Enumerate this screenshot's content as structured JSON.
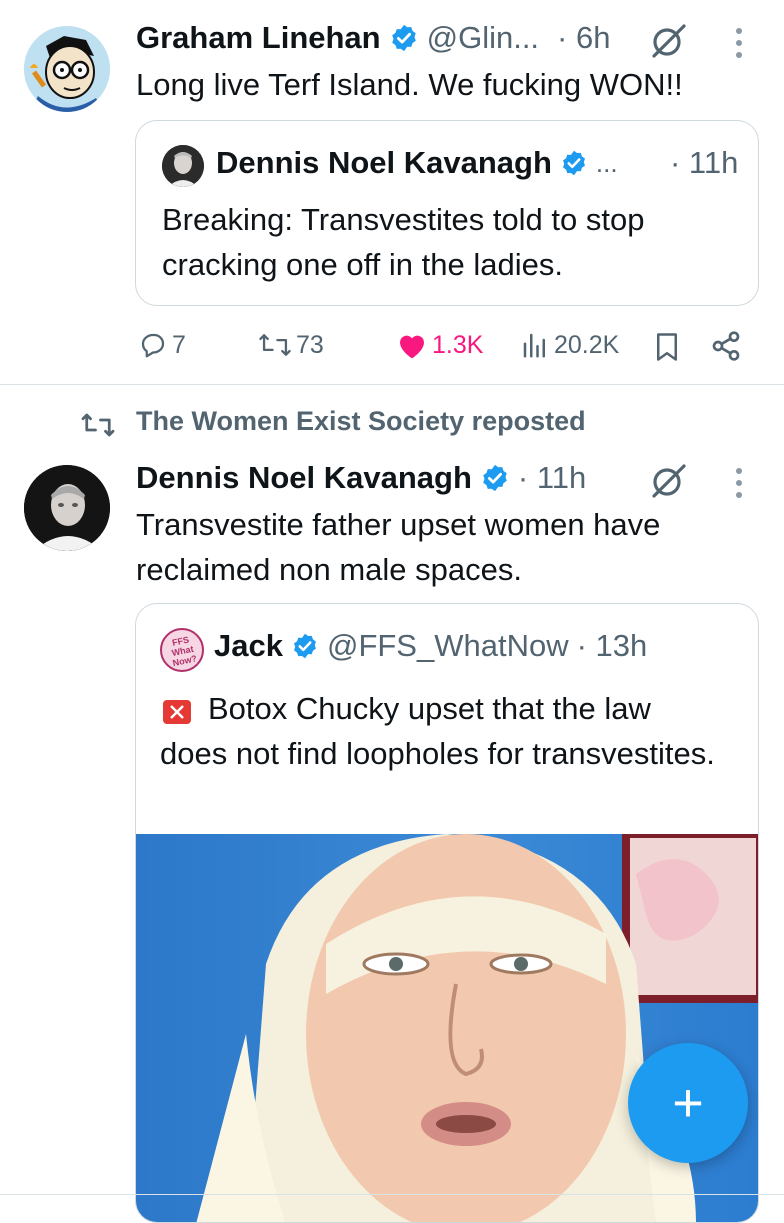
{
  "tweet1": {
    "author": "Graham Linehan",
    "handle": "@Glin...",
    "time": "· 6h",
    "text": "Long live Terf Island. We fucking WON!!",
    "quote": {
      "author": "Dennis Noel Kavanagh",
      "handle": "...",
      "time": "· 11h",
      "text": "Breaking: Transvestites told to stop cracking one off in the ladies."
    },
    "actions": {
      "replies": "7",
      "reposts": "73",
      "likes": "1.3K",
      "views": "20.2K"
    }
  },
  "repost_banner": {
    "text": "The Women Exist Society reposted"
  },
  "tweet2": {
    "author": "Dennis Noel Kavanagh",
    "time": "· 11h",
    "text": "Transvestite father upset women have reclaimed non male spaces.",
    "quote": {
      "author": "Jack",
      "handle": "@FFS_WhatNow",
      "time": "· 13h",
      "text": "Botox Chucky upset that the law does not find loopholes for transvestites.",
      "avatar_text": "FFS What Now?"
    }
  },
  "fab": {
    "icon": "plus-icon",
    "label": "+"
  },
  "colors": {
    "accent": "#1d9bf0",
    "like": "#f91880",
    "muted": "#536471",
    "border": "#cfd9de"
  }
}
